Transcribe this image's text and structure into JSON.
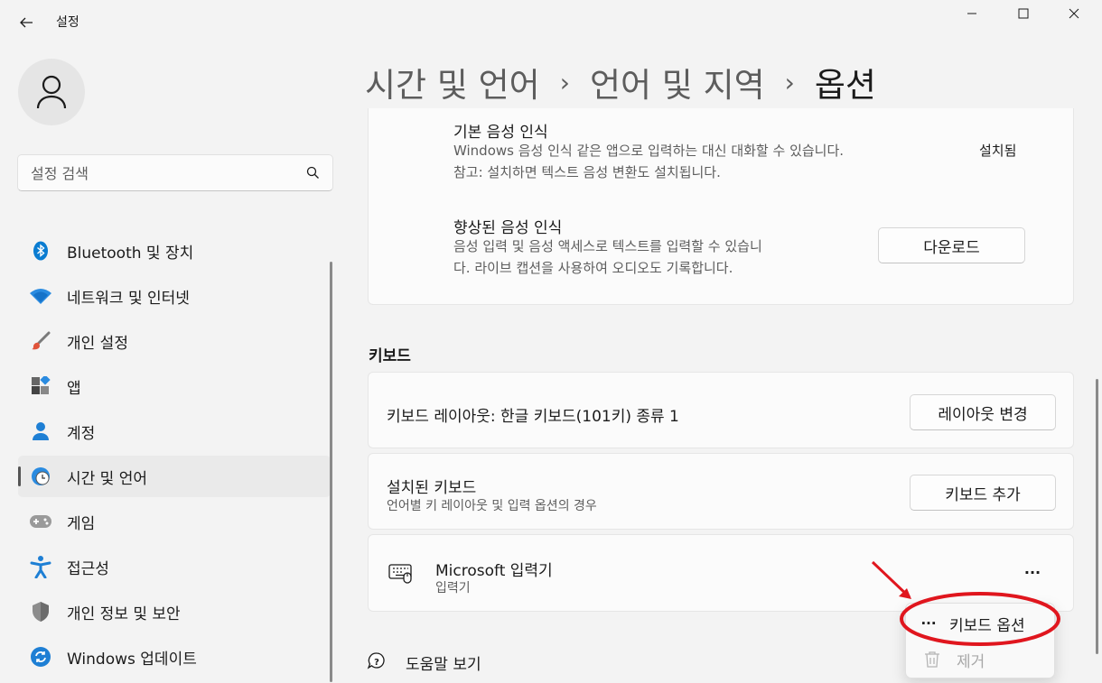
{
  "window": {
    "app_title": "설정"
  },
  "search": {
    "placeholder": "설정 검색"
  },
  "nav": {
    "items": [
      {
        "label": "Bluetooth 및 장치",
        "icon": "bluetooth-icon"
      },
      {
        "label": "네트워크 및 인터넷",
        "icon": "wifi-icon"
      },
      {
        "label": "개인 설정",
        "icon": "brush-icon"
      },
      {
        "label": "앱",
        "icon": "apps-icon"
      },
      {
        "label": "계정",
        "icon": "account-icon"
      },
      {
        "label": "시간 및 언어",
        "icon": "globe-clock-icon",
        "active": true
      },
      {
        "label": "게임",
        "icon": "gamepad-icon"
      },
      {
        "label": "접근성",
        "icon": "accessibility-icon"
      },
      {
        "label": "개인 정보 및 보안",
        "icon": "shield-icon"
      },
      {
        "label": "Windows 업데이트",
        "icon": "update-icon"
      }
    ]
  },
  "breadcrumb": {
    "level1": "시간 및 언어",
    "level2": "언어 및 지역",
    "current": "옵션",
    "separator": "›"
  },
  "speech": {
    "basic": {
      "title": "기본 음성 인식",
      "desc_line1": "Windows 음성 인식 같은 앱으로 입력하는 대신 대화할 수 있습니다.",
      "desc_line2": "참고: 설치하면 텍스트 음성 변환도 설치됩니다.",
      "status": "설치됨"
    },
    "enhanced": {
      "title": "향상된 음성 인식",
      "desc_line1": "음성 입력 및 음성 액세스로 텍스트를 입력할 수 있습니",
      "desc_line2": "다. 라이브 캡션을 사용하여 오디오도 기록합니다.",
      "button": "다운로드"
    }
  },
  "keyboard": {
    "section_title": "키보드",
    "layout": {
      "label": "키보드 레이아웃: 한글 키보드(101키) 종류 1",
      "button": "레이아웃 변경"
    },
    "installed": {
      "title": "설치된 키보드",
      "subtitle": "언어별 키 레이아웃 및 입력 옵션의 경우",
      "button": "키보드 추가"
    },
    "ime": {
      "title": "Microsoft 입력기",
      "subtitle": "입력기",
      "more": "···"
    }
  },
  "context_menu": {
    "options_label": "키보드 옵션",
    "remove_label": "제거"
  },
  "help": {
    "label": "도움말 보기"
  },
  "annotation": {
    "color": "#e0161e"
  }
}
